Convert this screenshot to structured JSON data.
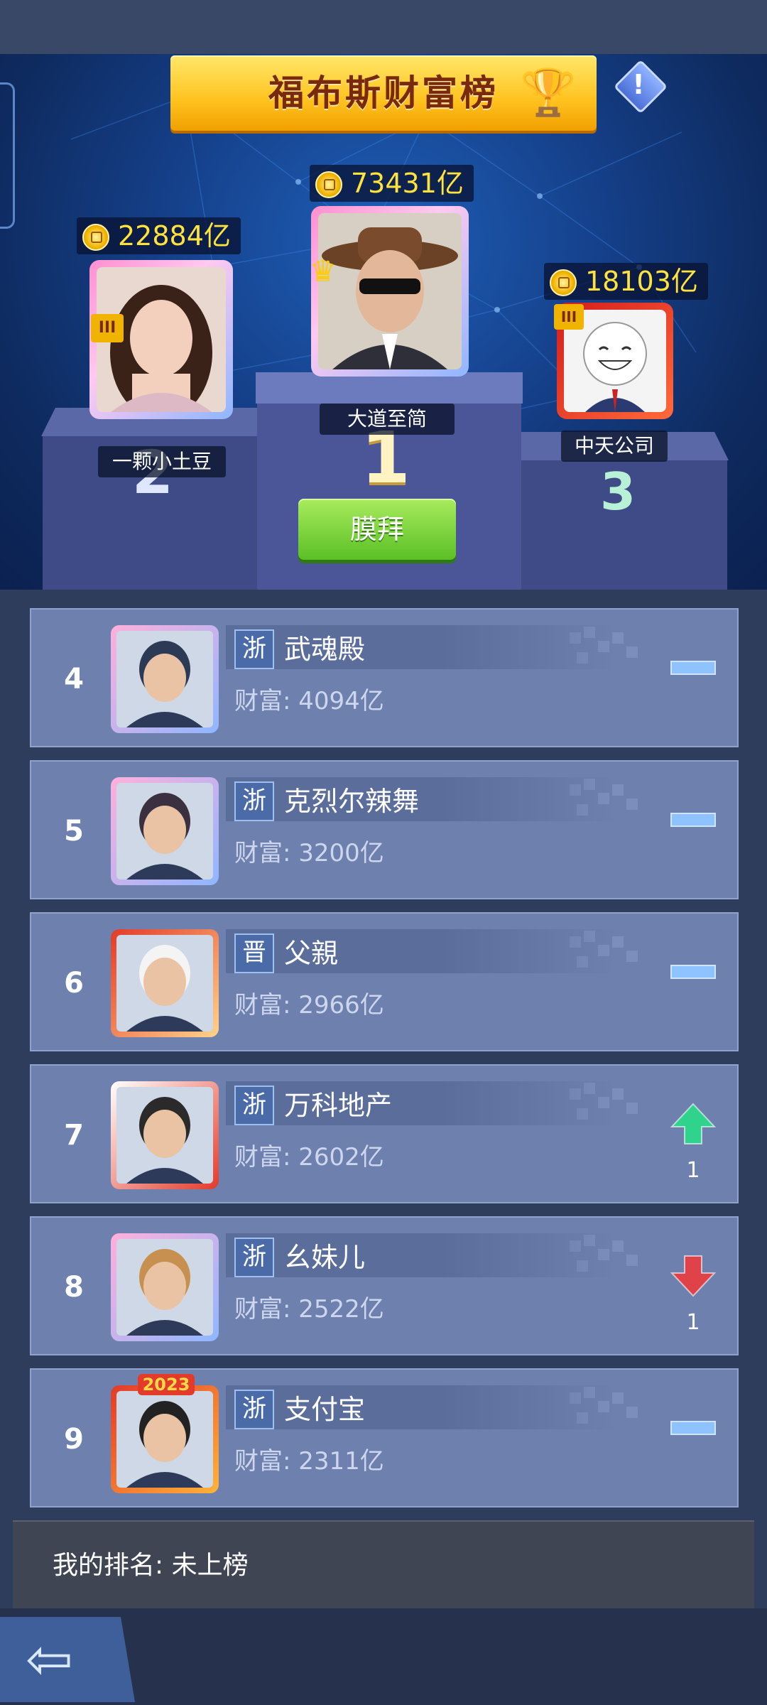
{
  "header": {
    "title": "福布斯财富榜",
    "info_label": "!"
  },
  "podium": [
    {
      "rank": "2",
      "name": "一颗小土豆",
      "wealth": "22884亿",
      "crown": "III"
    },
    {
      "rank": "1",
      "name": "大道至简",
      "wealth": "73431亿",
      "crown": "crown-icon"
    },
    {
      "rank": "3",
      "name": "中天公司",
      "wealth": "18103亿",
      "crown": "III"
    }
  ],
  "worship_button": "膜拜",
  "list": [
    {
      "rank": "4",
      "province": "浙",
      "name": "武魂殿",
      "wealth_label": "财富:",
      "wealth": "4094亿",
      "trend": "flat",
      "change": ""
    },
    {
      "rank": "5",
      "province": "浙",
      "name": "克烈尔辣舞",
      "wealth_label": "财富:",
      "wealth": "3200亿",
      "trend": "flat",
      "change": ""
    },
    {
      "rank": "6",
      "province": "晋",
      "name": "父親",
      "wealth_label": "财富:",
      "wealth": "2966亿",
      "trend": "flat",
      "change": ""
    },
    {
      "rank": "7",
      "province": "浙",
      "name": "万科地产",
      "wealth_label": "财富:",
      "wealth": "2602亿",
      "trend": "up",
      "change": "1"
    },
    {
      "rank": "8",
      "province": "浙",
      "name": "幺妹儿",
      "wealth_label": "财富:",
      "wealth": "2522亿",
      "trend": "down",
      "change": "1"
    },
    {
      "rank": "9",
      "province": "浙",
      "name": "支付宝",
      "wealth_label": "财富:",
      "wealth": "2311亿",
      "trend": "flat",
      "change": "",
      "badge": "2023"
    }
  ],
  "my_rank": "我的排名: 未上榜",
  "colors": {
    "up": "#2fd38c",
    "down": "#e0424a",
    "flat": "#8fc3ff",
    "gold": "#ffe23c"
  }
}
